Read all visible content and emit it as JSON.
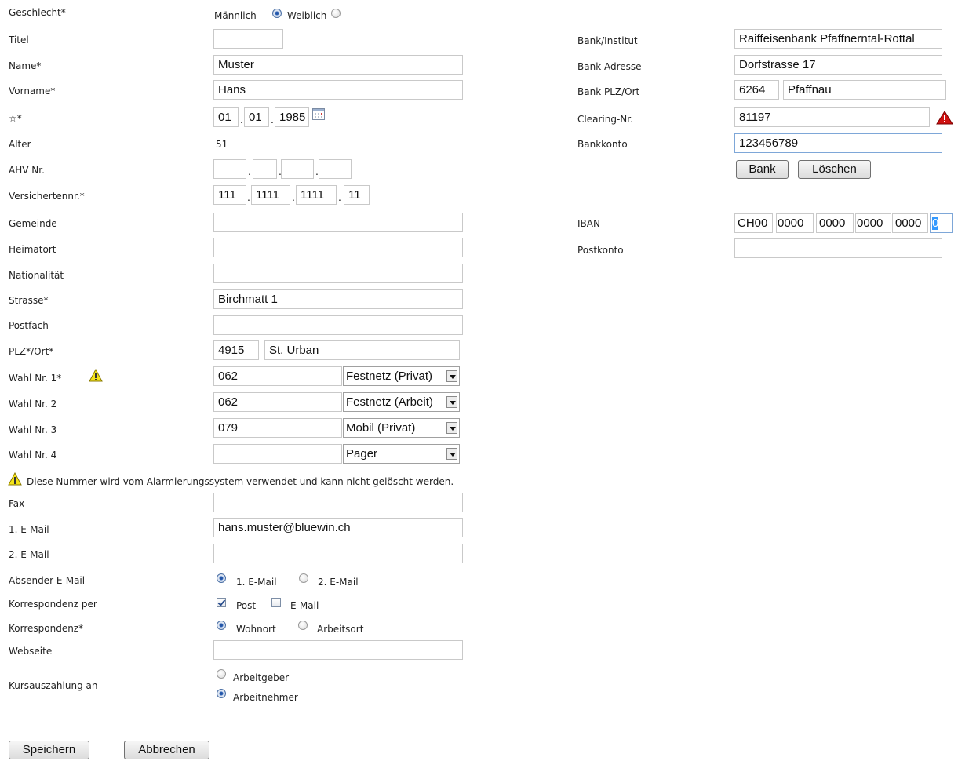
{
  "colors": {
    "warning_yellow": "#f4e41a",
    "warning_red": "#d01010",
    "radio_selected": "#2c5fb3"
  },
  "left": {
    "geschlecht": {
      "label": "Geschlecht*",
      "opt1": "Männlich",
      "opt2": "Weiblich",
      "selected": "opt1"
    },
    "titel": {
      "label": "Titel",
      "value": ""
    },
    "name": {
      "label": "Name*",
      "value": "Muster"
    },
    "vorname": {
      "label": "Vorname*",
      "value": "Hans"
    },
    "geburtsdatum": {
      "label": "☆*",
      "day": "01",
      "month": "01",
      "year": "1985",
      "icon": "calendar-icon"
    },
    "alter": {
      "label": "Alter",
      "value": "51"
    },
    "ahv": {
      "label": "AHV Nr.",
      "p1": "",
      "p2": "",
      "p3": "",
      "p4": ""
    },
    "versichertennr": {
      "label": "Versichertennr.*",
      "p1": "111",
      "p2": "1111",
      "p3": "1111",
      "p4": "11"
    },
    "gemeinde": {
      "label": "Gemeinde",
      "value": ""
    },
    "heimatort": {
      "label": "Heimatort",
      "value": ""
    },
    "nationalitaet": {
      "label": "Nationalität",
      "value": ""
    },
    "strasse": {
      "label": "Strasse*",
      "value": "Birchmatt 1"
    },
    "postfach": {
      "label": "Postfach",
      "value": ""
    },
    "plz_ort": {
      "label": "PLZ*/Ort*",
      "plz": "4915",
      "ort": "St. Urban"
    },
    "wahl": [
      {
        "label": "Wahl Nr. 1*",
        "number": "062",
        "type": "Festnetz (Privat)"
      },
      {
        "label": "Wahl Nr. 2",
        "number": "062",
        "type": "Festnetz (Arbeit)"
      },
      {
        "label": "Wahl Nr. 3",
        "number": "079",
        "type": "Mobil (Privat)"
      },
      {
        "label": "Wahl Nr. 4",
        "number": "",
        "type": "Pager"
      }
    ],
    "warning_note": "Diese Nummer wird vom Alarmierungssystem verwendet und kann nicht gelöscht werden.",
    "fax": {
      "label": "Fax",
      "value": ""
    },
    "email1": {
      "label": "1. E-Mail",
      "value": "hans.muster@bluewin.ch"
    },
    "email2": {
      "label": "2. E-Mail",
      "value": ""
    },
    "absender": {
      "label": "Absender E-Mail",
      "opt1": "1. E-Mail",
      "opt2": "2. E-Mail",
      "selected": "opt1"
    },
    "korr_per": {
      "label": "Korrespondenz per",
      "opt1": "Post",
      "opt2": "E-Mail",
      "checked_post": true,
      "checked_email": false
    },
    "korr": {
      "label": "Korrespondenz*",
      "opt1": "Wohnort",
      "opt2": "Arbeitsort",
      "selected": "opt1"
    },
    "webseite": {
      "label": "Webseite",
      "value": ""
    },
    "kurs": {
      "label": "Kursauszahlung an",
      "opt1": "Arbeitgeber",
      "opt2": "Arbeitnehmer",
      "selected": "opt2"
    }
  },
  "right": {
    "bank_institut": {
      "label": "Bank/Institut",
      "value": "Raiffeisenbank Pfaffnerntal-Rottal"
    },
    "bank_adresse": {
      "label": "Bank Adresse",
      "value": "Dorfstrasse 17"
    },
    "bank_plz_ort": {
      "label": "Bank PLZ/Ort",
      "plz": "6264",
      "ort": "Pfaffnau"
    },
    "clearing": {
      "label": "Clearing-Nr.",
      "value": "81197"
    },
    "bankkonto": {
      "label": "Bankkonto",
      "value": "123456789"
    },
    "bank_button": "Bank",
    "loeschen_button": "Löschen",
    "iban": {
      "label": "IBAN",
      "p1": "CH00",
      "p2": "0000",
      "p3": "0000",
      "p4": "0000",
      "p5": "0000",
      "p6": "0"
    },
    "postkonto": {
      "label": "Postkonto",
      "value": ""
    }
  },
  "footer": {
    "save": "Speichern",
    "cancel": "Abbrechen"
  }
}
